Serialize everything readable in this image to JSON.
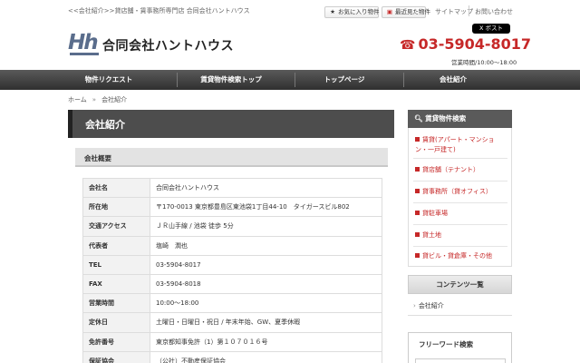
{
  "topbar": {
    "tagline": "<<会社紹介>>貸店舗・賃事務所専門店 合同会社ハントハウス",
    "favorites": "お気に入り物件",
    "recent": "最近見た物件",
    "sitemap": "サイトマップ",
    "contact": "お問い合わせ"
  },
  "header": {
    "logo_text": "Hh",
    "company": "合同会社ハントハウス",
    "x_post": "X ポスト",
    "phone": "03-5904-8017",
    "hours": "営業時間/10:00～18:00"
  },
  "nav": [
    "物件リクエスト",
    "賃貸物件検索トップ",
    "トップページ",
    "会社紹介"
  ],
  "breadcrumb": {
    "home": "ホーム",
    "current": "会社紹介"
  },
  "main": {
    "title": "会社紹介",
    "section": "会社概要",
    "rows": [
      {
        "k": "会社名",
        "v": "合同会社ハントハウス"
      },
      {
        "k": "所在地",
        "v": "〒170-0013 東京都豊島区東池袋1丁目44-10　タイガースビル802"
      },
      {
        "k": "交通アクセス",
        "v": "ＪＲ山手線 / 池袋 徒歩 5分"
      },
      {
        "k": "代表者",
        "v": "塩崎　潤也"
      },
      {
        "k": "TEL",
        "v": "03-5904-8017"
      },
      {
        "k": "FAX",
        "v": "03-5904-8018"
      },
      {
        "k": "営業時間",
        "v": "10:00～18:00"
      },
      {
        "k": "定休日",
        "v": "土曜日・日曜日・祝日 / 年末年始、GW、夏季休暇"
      },
      {
        "k": "免許番号",
        "v": "東京都知事免許（1）第１０７０１６号"
      },
      {
        "k": "保証協会",
        "v": "（公社）不動産保証協会"
      }
    ]
  },
  "sidebar": {
    "search_title": "賃貸物件検索",
    "items": [
      "賃貸(アパート・マンション・一戸建て)",
      "貸店舗（テナント）",
      "貸事務所（貸オフィス）",
      "貸駐車場",
      "貸土地",
      "貸ビル・貸倉庫・その他"
    ],
    "contents_title": "コンテンツ一覧",
    "contents_link": "会社紹介",
    "freeword_title": "フリーワード検索"
  },
  "colors": {
    "accent": "#c62828",
    "nav": "#3a3a3a",
    "logo": "#5a6d8c"
  }
}
